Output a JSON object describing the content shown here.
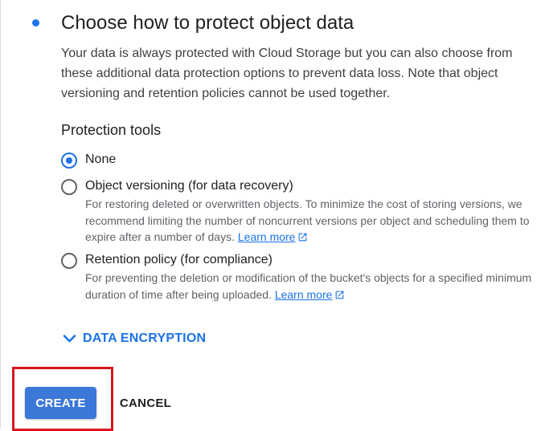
{
  "section": {
    "title": "Choose how to protect object data",
    "intro": "Your data is always protected with Cloud Storage but you can also choose from these additional data protection options to prevent data loss. Note that object versioning and retention policies cannot be used together."
  },
  "protection_tools": {
    "heading": "Protection tools",
    "selected": "None",
    "options": [
      {
        "label": "None",
        "checked": true
      },
      {
        "label": "Object versioning (for data recovery)",
        "checked": false,
        "description": "For restoring deleted or overwritten objects. To minimize the cost of storing versions, we recommend limiting the number of noncurrent versions per object and scheduling them to expire after a number of days.",
        "link": "Learn more"
      },
      {
        "label": "Retention policy (for compliance)",
        "checked": false,
        "description": "For preventing the deletion or modification of the bucket's objects for a specified minimum duration of time after being uploaded.",
        "link": "Learn more"
      }
    ]
  },
  "encryption_toggle": {
    "label": "DATA ENCRYPTION",
    "icon": "chevron-down-icon"
  },
  "actions": {
    "create": "CREATE",
    "cancel": "CANCEL"
  },
  "icons": {
    "step_marker": "dot-icon",
    "external_link": "external-link-icon"
  },
  "colors": {
    "accent": "#1a73e8",
    "create_button": "#3c78d8",
    "highlight": "#d9141f",
    "secondary_text": "#5f6368"
  }
}
